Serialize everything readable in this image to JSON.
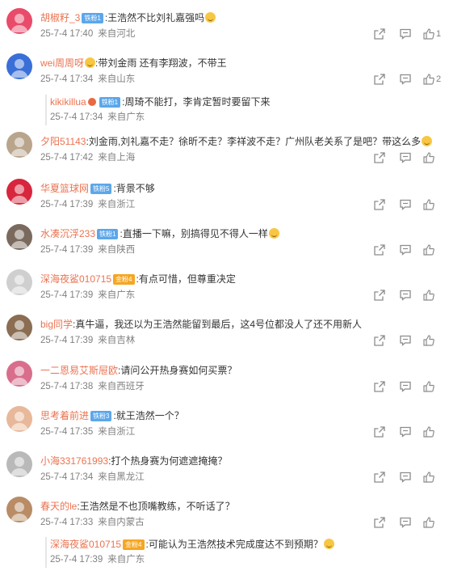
{
  "comments": [
    {
      "user": "胡椒籽_3",
      "badge": "铁粉1",
      "badge_color": "blue",
      "text": ":王浩然不比刘礼嘉强吗",
      "emoji": "laugh-cry",
      "time": "25-7-4 17:40",
      "source": "来自河北",
      "likes": "1"
    },
    {
      "user": "wei周周呀",
      "badge": "",
      "prefix_emoji": "laugh-cry",
      "text": ":带刘金雨 还有李翔波，不带王",
      "time": "25-7-4 17:34",
      "source": "来自山东",
      "likes": "2",
      "reply": {
        "user": "kikikillua",
        "badge": "铁粉1",
        "badge_color": "blue",
        "text": ":周琦不能打，李肯定暂时要留下来",
        "time": "25-7-4 17:34",
        "source": "来自广东"
      }
    },
    {
      "user": "夕阳51143",
      "badge": "",
      "emoji": "laugh-cry",
      "text": ":刘金雨,刘礼嘉不走？徐昕不走？李祥波不走？广州队老关系了是吧？带这么多",
      "time": "25-7-4 17:42",
      "source": "来自上海",
      "likes": ""
    },
    {
      "user": "华夏篮球网",
      "badge": "铁粉5",
      "badge_color": "blue",
      "text": ":背景不够",
      "time": "25-7-4 17:39",
      "source": "来自浙江",
      "likes": ""
    },
    {
      "user": "水凑沉浮233",
      "badge": "铁粉1",
      "badge_color": "blue",
      "text": ":直播一下嘛，别搞得见不得人一样",
      "emoji": "grin",
      "time": "25-7-4 17:39",
      "source": "来自陕西",
      "likes": ""
    },
    {
      "user": "深海夜鲨010715",
      "badge": "金粉4",
      "badge_color": "orange",
      "text": ":有点可惜，但尊重决定",
      "time": "25-7-4 17:39",
      "source": "来自广东",
      "likes": ""
    },
    {
      "user": "big同学",
      "badge": "",
      "text": ":真牛逼，我还以为王浩然能留到最后，这4号位都没人了还不用新人",
      "time": "25-7-4 17:39",
      "source": "来自吉林",
      "likes": ""
    },
    {
      "user": "一二恩易艾斯屉欧",
      "badge": "",
      "text": ":请问公开热身赛如何买票？",
      "time": "25-7-4 17:38",
      "source": "来自西班牙",
      "likes": ""
    },
    {
      "user": "思考着前进",
      "badge": "铁粉3",
      "badge_color": "blue",
      "text": ":就王浩然一个？",
      "time": "25-7-4 17:35",
      "source": "来自浙江",
      "likes": ""
    },
    {
      "user": "小海331761993",
      "badge": "",
      "text": ":打个热身赛为何遮遮掩掩？",
      "time": "25-7-4 17:34",
      "source": "来自黑龙江",
      "likes": ""
    },
    {
      "user": "春天的le",
      "badge": "",
      "text": ":王浩然是不也顶嘴教练，不听话了？",
      "time": "25-7-4 17:33",
      "source": "来自内蒙古",
      "likes": "",
      "reply": {
        "user": "深海夜鲨010715",
        "badge": "金粉4",
        "badge_color": "orange",
        "text": ":可能认为王浩然技术完成度达不到预期？",
        "emoji": "thinking",
        "time": "25-7-4 17:39",
        "source": "来自广东"
      }
    }
  ],
  "icons": {
    "share": "share-icon",
    "comment": "comment-icon",
    "like": "like-icon"
  },
  "colors": {
    "username": "#eb7350",
    "meta": "#808080",
    "badge_blue": "#5ca7ea",
    "badge_orange": "#f5a623"
  }
}
